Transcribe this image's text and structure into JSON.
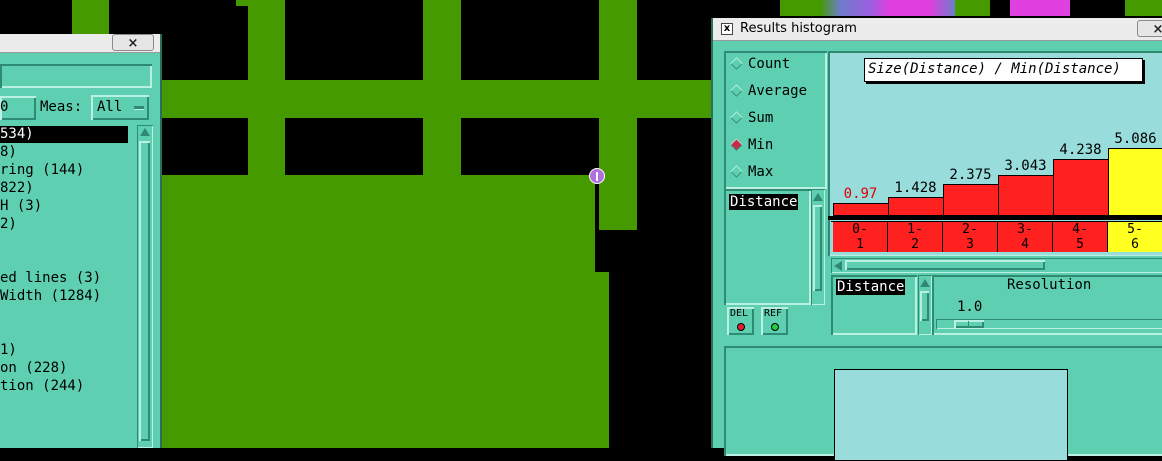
{
  "left_dialog": {
    "close_label": "×",
    "meas_label": "Meas:",
    "meas_value": "All",
    "list_items": [
      "534)",
      "8)",
      "ring (144)",
      "822)",
      "H (3)",
      "2)",
      "",
      "",
      "ed lines (3)",
      "Width (1284)",
      "",
      "",
      "1)",
      "on (228)",
      "tion (244)"
    ]
  },
  "right_dialog": {
    "title": "Results histogram",
    "close_label": "×",
    "modes": [
      {
        "label": "Count",
        "selected": false
      },
      {
        "label": "Average",
        "selected": false
      },
      {
        "label": "Sum",
        "selected": false
      },
      {
        "label": "Min",
        "selected": true
      },
      {
        "label": "Max",
        "selected": false
      }
    ],
    "formula": "Size(Distance) / Min(Distance)",
    "list_item": "Distance",
    "del_label": "DEL",
    "ref_label": "REF",
    "measure_label": "Distance",
    "resolution_title": "Resolution",
    "resolution_value": "1.0"
  },
  "chart_data": {
    "type": "bar",
    "title": "Size(Distance) / Min(Distance)",
    "categories": [
      "0-1",
      "1-2",
      "2-3",
      "3-4",
      "4-5",
      "5-6"
    ],
    "category_labels": [
      [
        "0-",
        "1"
      ],
      [
        "1-",
        "2"
      ],
      [
        "2-",
        "3"
      ],
      [
        "3-",
        "4"
      ],
      [
        "4-",
        "5"
      ],
      [
        "5-",
        "6"
      ]
    ],
    "values": [
      0.97,
      1.428,
      2.375,
      3.043,
      4.238,
      5.086
    ],
    "value_labels": [
      "0.97",
      "1.428",
      "2.375",
      "3.043",
      "4.238",
      "5.086"
    ],
    "colors": [
      "#ff2020",
      "#ff2020",
      "#ff2020",
      "#ff2020",
      "#ff2020",
      "#ffff20"
    ],
    "label_colors": [
      "#e00000",
      "#000000",
      "#000000",
      "#000000",
      "#000000",
      "#000000"
    ],
    "highlight_color": "#ffff20",
    "bar_color": "#ff2020"
  },
  "colors": {
    "layout_green": "#459a00",
    "panel": "#5ecfb1",
    "marker": "#b070e0"
  }
}
